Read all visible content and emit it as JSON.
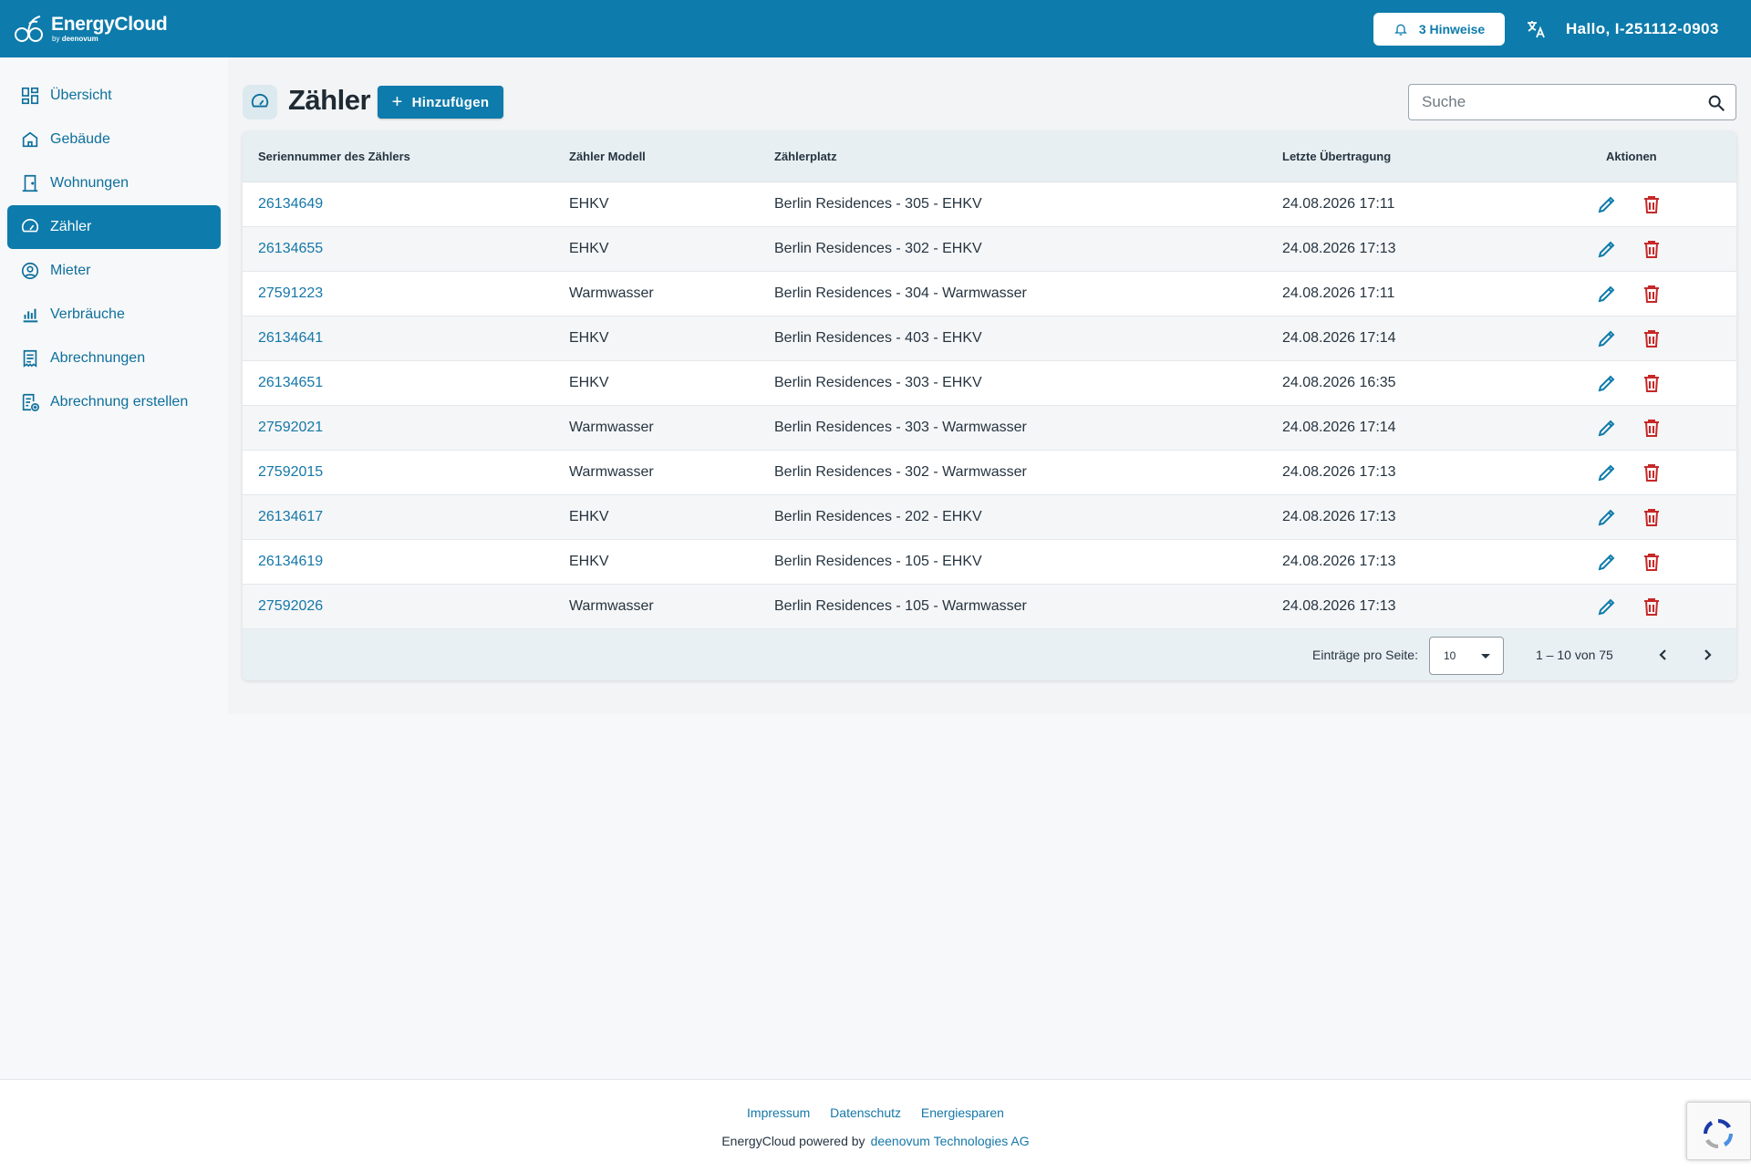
{
  "header": {
    "brand": "EnergyCloud",
    "brand_by": "by",
    "brand_company": "deenovum",
    "hints_label": "3 Hinweise",
    "greeting": "Hallo, I-251112-0903"
  },
  "sidebar": {
    "items": [
      {
        "label": "Übersicht",
        "icon": "dashboard-icon"
      },
      {
        "label": "Gebäude",
        "icon": "home-icon"
      },
      {
        "label": "Wohnungen",
        "icon": "door-icon"
      },
      {
        "label": "Zähler",
        "icon": "gauge-icon",
        "active": true
      },
      {
        "label": "Mieter",
        "icon": "person-icon"
      },
      {
        "label": "Verbräuche",
        "icon": "bar-chart-icon"
      },
      {
        "label": "Abrechnungen",
        "icon": "receipt-icon"
      },
      {
        "label": "Abrechnung erstellen",
        "icon": "create-invoice-icon"
      }
    ]
  },
  "page": {
    "title": "Zähler",
    "add_label": "Hinzufügen",
    "search_placeholder": "Suche"
  },
  "table": {
    "columns": [
      "Seriennummer des Zählers",
      "Zähler Modell",
      "Zählerplatz",
      "Letzte Übertragung",
      "Aktionen"
    ],
    "rows": [
      {
        "serial": "26134649",
        "model": "EHKV",
        "place": "Berlin Residences - 305 - EHKV",
        "last": "24.08.2026 17:11"
      },
      {
        "serial": "26134655",
        "model": "EHKV",
        "place": "Berlin Residences - 302 - EHKV",
        "last": "24.08.2026 17:13"
      },
      {
        "serial": "27591223",
        "model": "Warmwasser",
        "place": "Berlin Residences - 304 - Warmwasser",
        "last": "24.08.2026 17:11"
      },
      {
        "serial": "26134641",
        "model": "EHKV",
        "place": "Berlin Residences - 403 - EHKV",
        "last": "24.08.2026 17:14"
      },
      {
        "serial": "26134651",
        "model": "EHKV",
        "place": "Berlin Residences - 303 - EHKV",
        "last": "24.08.2026 16:35"
      },
      {
        "serial": "27592021",
        "model": "Warmwasser",
        "place": "Berlin Residences - 303 - Warmwasser",
        "last": "24.08.2026 17:14"
      },
      {
        "serial": "27592015",
        "model": "Warmwasser",
        "place": "Berlin Residences - 302 - Warmwasser",
        "last": "24.08.2026 17:13"
      },
      {
        "serial": "26134617",
        "model": "EHKV",
        "place": "Berlin Residences - 202 - EHKV",
        "last": "24.08.2026 17:13"
      },
      {
        "serial": "26134619",
        "model": "EHKV",
        "place": "Berlin Residences - 105 - EHKV",
        "last": "24.08.2026 17:13"
      },
      {
        "serial": "27592026",
        "model": "Warmwasser",
        "place": "Berlin Residences - 105 - Warmwasser",
        "last": "24.08.2026 17:13"
      }
    ],
    "per_page_label": "Einträge pro Seite:",
    "per_page_value": "10",
    "range_label": "1 – 10 von 75"
  },
  "footer": {
    "links": [
      "Impressum",
      "Datenschutz",
      "Energiesparen"
    ],
    "powered_by": "EnergyCloud powered by",
    "company_link": "deenovum Technologies AG"
  },
  "colors": {
    "brand": "#0d7bab",
    "link": "#1577a8",
    "delete": "#c62828"
  }
}
